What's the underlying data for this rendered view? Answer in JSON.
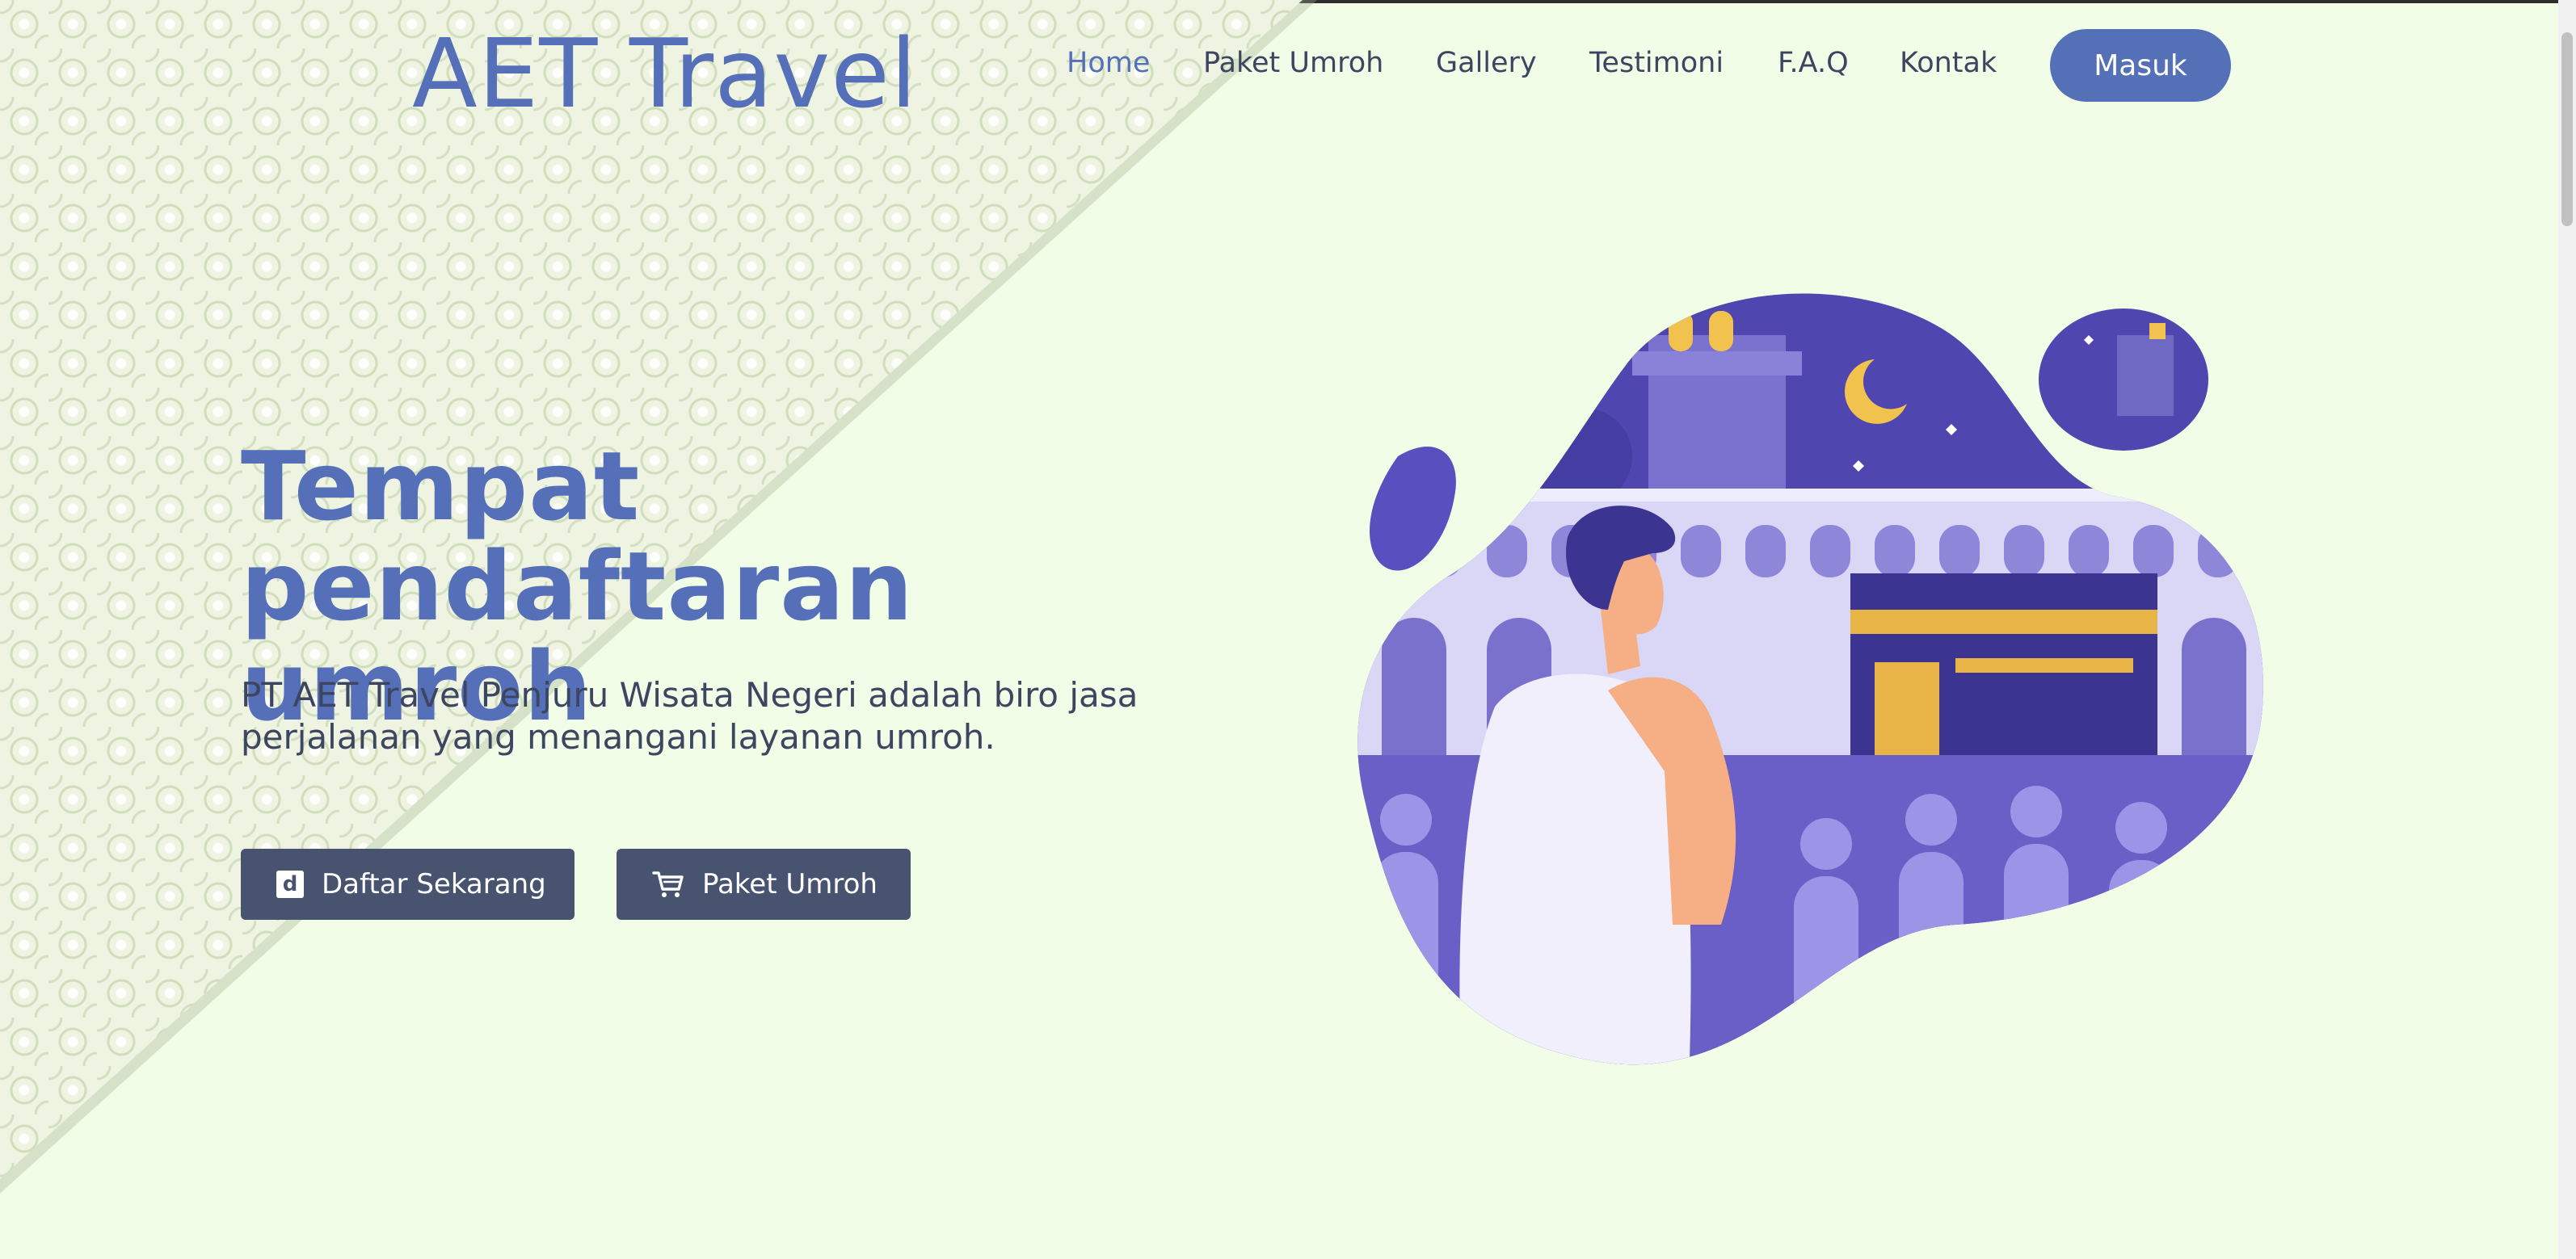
{
  "brand": {
    "name": "AET Travel"
  },
  "nav": {
    "items": [
      {
        "label": "Home",
        "active": true
      },
      {
        "label": "Paket Umroh",
        "active": false
      },
      {
        "label": "Gallery",
        "active": false
      },
      {
        "label": "Testimoni",
        "active": false
      },
      {
        "label": "F.A.Q",
        "active": false
      },
      {
        "label": "Kontak",
        "active": false
      }
    ],
    "login_label": "Masuk"
  },
  "hero": {
    "title_line1": "Tempat pendaftaran",
    "title_line2": "umroh",
    "description": "PT AET Travel Penjuru Wisata Negeri adalah biro jasa perjalanan yang menangani layanan umroh.",
    "register_button": "Daftar Sekarang",
    "register_icon": "d",
    "packages_button": "Paket Umroh"
  },
  "icons": {
    "register": "register-icon",
    "packages": "cart-icon",
    "illustration": "pilgrim-kaaba-illustration"
  },
  "colors": {
    "accent": "#5570b8",
    "background": "#f2fde8",
    "button_dark": "#48536f",
    "text": "#3d4660"
  }
}
